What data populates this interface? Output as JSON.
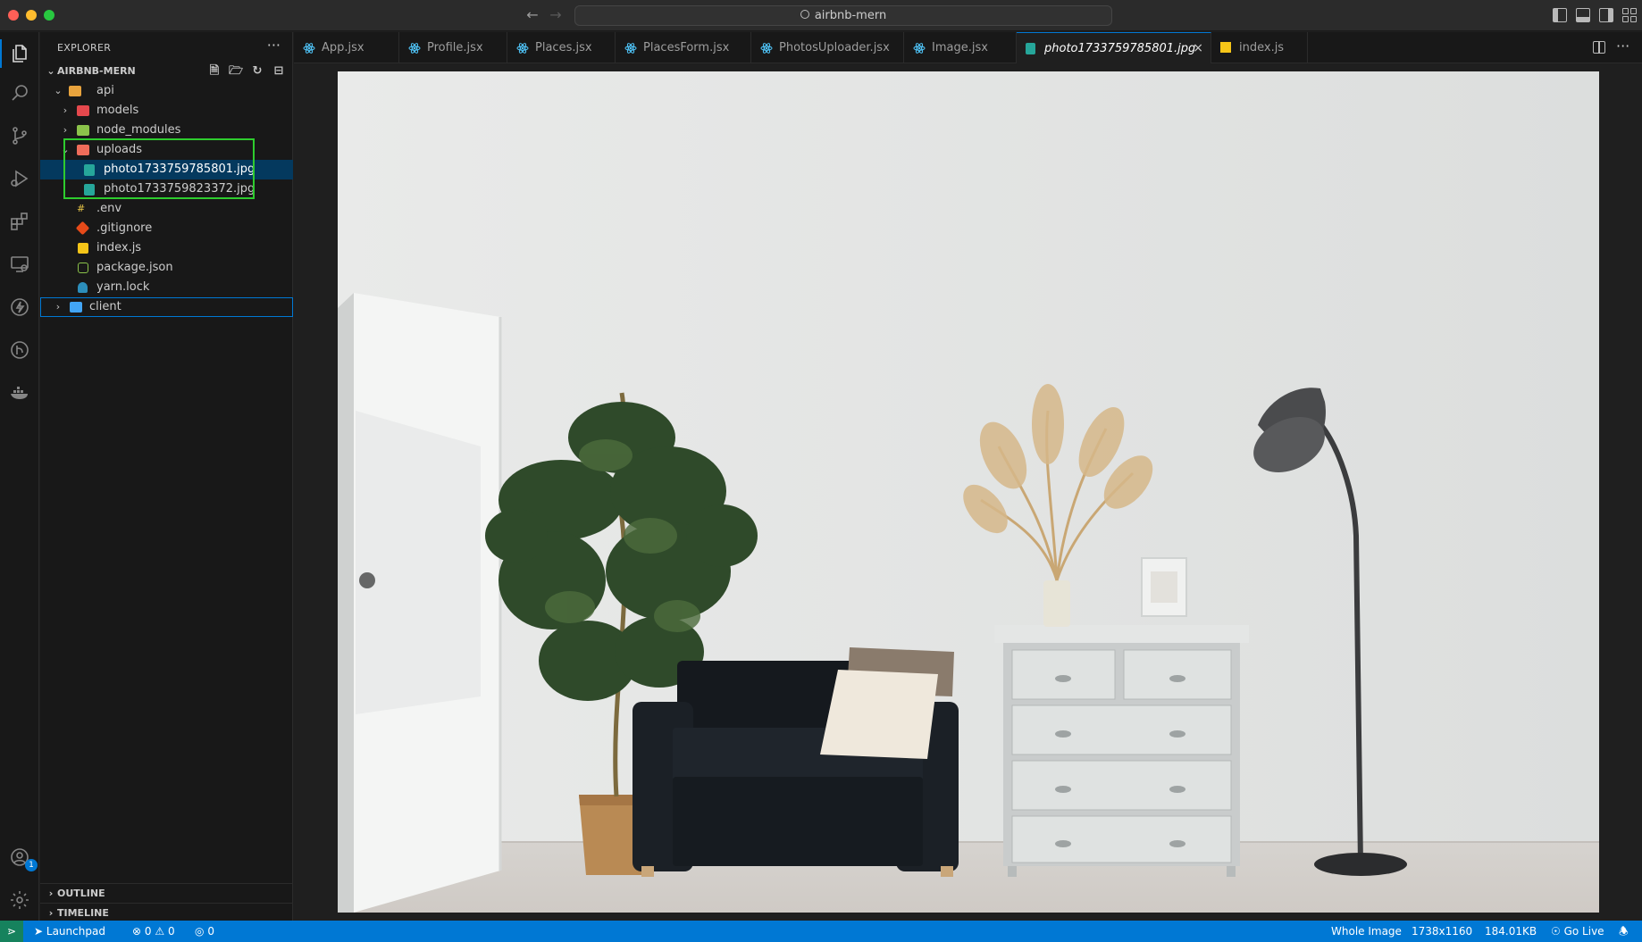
{
  "window": {
    "title": "airbnb-mern"
  },
  "titlebar": {
    "back_icon": "arrow-left-icon",
    "forward_icon": "arrow-right-icon"
  },
  "activity_bar": {
    "items": [
      "explorer",
      "search",
      "source-control",
      "run-and-debug",
      "extensions",
      "remote-explorer",
      "lightning",
      "git-graph",
      "docker"
    ],
    "bottom": [
      "accounts",
      "manage"
    ],
    "accounts_badge": "1"
  },
  "sidebar": {
    "title": "EXPLORER",
    "more": "···",
    "root": "AIRBNB-MERN",
    "tree": [
      {
        "label": "api",
        "icon": "folder-api-icon",
        "expanded": true
      },
      {
        "label": "models",
        "icon": "folder-models-icon"
      },
      {
        "label": "node_modules",
        "icon": "folder-node-icon"
      },
      {
        "label": "uploads",
        "icon": "folder-uploads-icon",
        "expanded": true
      },
      {
        "label": "photo1733759785801.jpg",
        "icon": "image-file-icon",
        "selected": true
      },
      {
        "label": "photo1733759823372.jpg",
        "icon": "image-file-icon"
      },
      {
        "label": ".env",
        "icon": "env-file-icon"
      },
      {
        "label": ".gitignore",
        "icon": "git-file-icon"
      },
      {
        "label": "index.js",
        "icon": "js-file-icon"
      },
      {
        "label": "package.json",
        "icon": "nodejs-file-icon"
      },
      {
        "label": "yarn.lock",
        "icon": "yarn-file-icon"
      },
      {
        "label": "client",
        "icon": "folder-client-icon"
      }
    ],
    "outline": "OUTLINE",
    "timeline": "TIMELINE"
  },
  "tabs": [
    {
      "label": "App.jsx",
      "icon": "react-icon"
    },
    {
      "label": "Profile.jsx",
      "icon": "react-icon"
    },
    {
      "label": "Places.jsx",
      "icon": "react-icon"
    },
    {
      "label": "PlacesForm.jsx",
      "icon": "react-icon"
    },
    {
      "label": "PhotosUploader.jsx",
      "icon": "react-icon"
    },
    {
      "label": "Image.jsx",
      "icon": "react-icon"
    },
    {
      "label": "photo1733759785801.jpg",
      "icon": "image-file-icon",
      "active": true
    },
    {
      "label": "index.js",
      "icon": "js-file-icon"
    }
  ],
  "tab_close": "×",
  "statusbar": {
    "launchpad": "Launchpad",
    "errors": "0",
    "warnings": "0",
    "ports": "0",
    "zoom": "Whole Image",
    "dimensions": "1738x1160",
    "size": "184.01KB",
    "go_live": "Go Live"
  },
  "colors": {
    "accent": "#0078d4",
    "highlight_box": "#2ecc2e",
    "remote": "#16825d"
  }
}
